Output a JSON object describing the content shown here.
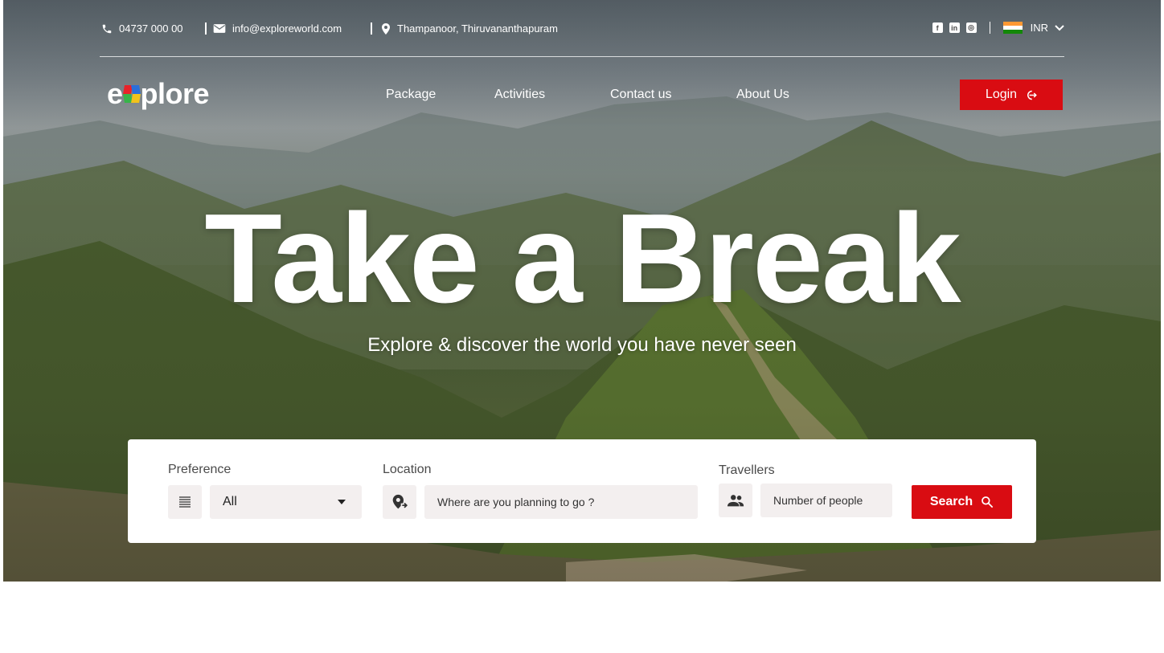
{
  "topbar": {
    "phone": "04737 000 00",
    "email": "info@exploreworld.com",
    "address": "Thampanoor, Thiruvananthapuram",
    "currency": "INR",
    "social": [
      "facebook-icon",
      "linkedin-icon",
      "instagram-icon"
    ]
  },
  "brand": {
    "logo_text_start": "e",
    "logo_text_end": "plore"
  },
  "nav": {
    "items": [
      "Package",
      "Activities",
      "Contact us",
      "About Us"
    ],
    "login": "Login"
  },
  "hero": {
    "title": "Take a Break",
    "subtitle": "Explore & discover the world you have never seen"
  },
  "search": {
    "preference_label": "Preference",
    "preference_value": "All",
    "location_label": "Location",
    "location_placeholder": "Where are you planning to go ?",
    "travellers_label": "Travellers",
    "travellers_placeholder": "Number of people",
    "button": "Search"
  },
  "colors": {
    "accent": "#d90c12",
    "field_bg": "#f3efef"
  }
}
